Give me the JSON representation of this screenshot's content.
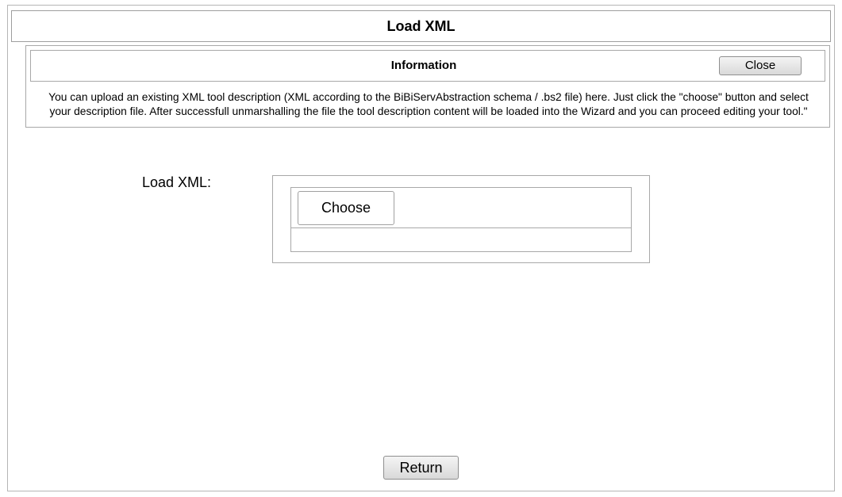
{
  "dialog": {
    "title": "Load XML"
  },
  "info": {
    "title": "Information",
    "close_label": "Close",
    "line1": "You can upload an existing XML tool description (XML according to the BiBiServAbstraction schema / .bs2 file) here. Just click the \"choose\" button and select",
    "line2": "your description file. After successfull unmarshalling the file the tool description content will be loaded into the Wizard and you can proceed editing your tool.\""
  },
  "upload": {
    "label": "Load XML:",
    "choose_label": "Choose"
  },
  "footer": {
    "return_label": "Return"
  }
}
